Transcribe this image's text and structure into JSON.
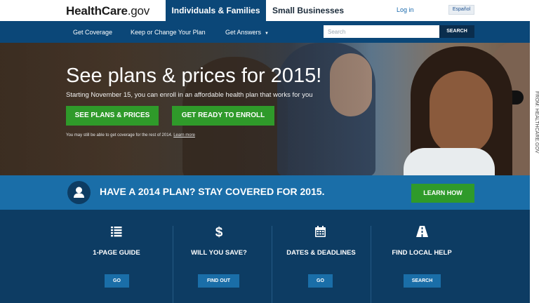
{
  "header": {
    "logo_main": "HealthCare",
    "logo_tld": ".gov",
    "tab_active": "Individuals & Families",
    "tab_other": "Small Businesses",
    "login": "Log in",
    "language": "Español"
  },
  "nav": {
    "items": [
      "Get Coverage",
      "Keep or Change Your Plan",
      "Get Answers"
    ],
    "dropdown_icon": "caret-down-icon"
  },
  "search": {
    "placeholder": "Search",
    "button": "SEARCH"
  },
  "hero": {
    "title": "See plans & prices for 2015!",
    "subtitle": "Starting November 15, you can enroll in an affordable health plan that works for you",
    "btn_plans": "SEE PLANS & PRICES",
    "btn_enroll": "GET READY TO ENROLL",
    "note": "You may still be able to get coverage for the rest of 2014.",
    "note_link": "Learn more"
  },
  "banner": {
    "icon": "person-icon",
    "title": "HAVE A 2014 PLAN? STAY COVERED FOR 2015.",
    "button": "LEARN HOW"
  },
  "features": [
    {
      "icon": "list-icon",
      "title": "1-PAGE GUIDE",
      "button": "GO"
    },
    {
      "icon": "dollar-icon",
      "title": "WILL YOU SAVE?",
      "button": "FIND OUT"
    },
    {
      "icon": "calendar-icon",
      "title": "DATES & DEADLINES",
      "button": "GO"
    },
    {
      "icon": "road-icon",
      "title": "FIND LOCAL HELP",
      "button": "SEARCH"
    }
  ],
  "credit": "FROM: HEALTHCARE.GOV",
  "colors": {
    "brand_blue": "#0b4778",
    "banner_blue": "#1a6ea8",
    "dark_navy": "#0d3c63",
    "green": "#2f9a2a"
  }
}
